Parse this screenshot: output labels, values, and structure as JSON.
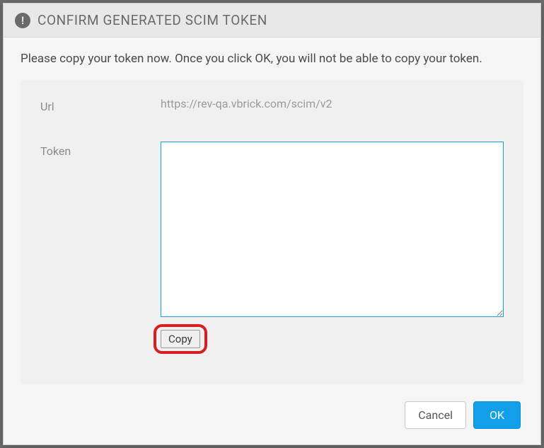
{
  "header": {
    "title": "CONFIRM GENERATED SCIM TOKEN",
    "icon_glyph": "!"
  },
  "body": {
    "instruction": "Please copy your token now. Once you click OK, you will not be able to copy your token.",
    "url_label": "Url",
    "url_value": "https://rev-qa.vbrick.com/scim/v2",
    "token_label": "Token",
    "token_value": "",
    "copy_label": "Copy"
  },
  "footer": {
    "cancel_label": "Cancel",
    "ok_label": "OK"
  }
}
